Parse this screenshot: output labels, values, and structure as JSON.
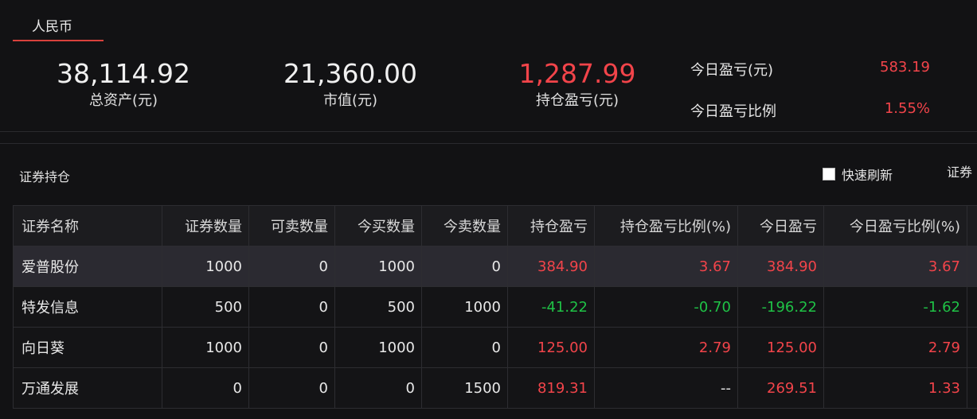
{
  "tab": {
    "label": "人民币"
  },
  "summary": {
    "total_assets": {
      "value": "38,114.92",
      "label": "总资产(元)"
    },
    "market_value": {
      "value": "21,360.00",
      "label": "市值(元)"
    },
    "position_pnl": {
      "value": "1,287.99",
      "label": "持仓盈亏(元)"
    },
    "today_pnl": {
      "label": "今日盈亏(元)",
      "value": "583.19"
    },
    "today_pnl_ratio": {
      "label": "今日盈亏比例",
      "value": "1.55%"
    }
  },
  "holdings": {
    "title": "证券持仓",
    "refresh_label": "快速刷新",
    "cut_label": "证券",
    "columns": [
      "证券名称",
      "证券数量",
      "可卖数量",
      "今买数量",
      "今卖数量",
      "持仓盈亏",
      "持仓盈亏比例(%)",
      "今日盈亏",
      "今日盈亏比例(%)"
    ],
    "rows": [
      {
        "name": "爱普股份",
        "qty": "1000",
        "sellable": "0",
        "bought": "1000",
        "sold": "0",
        "pnl": "384.90",
        "pnl_ratio": "3.67",
        "today": "384.90",
        "today_ratio": "3.67"
      },
      {
        "name": "特发信息",
        "qty": "500",
        "sellable": "0",
        "bought": "500",
        "sold": "1000",
        "pnl": "-41.22",
        "pnl_ratio": "-0.70",
        "today": "-196.22",
        "today_ratio": "-1.62"
      },
      {
        "name": "向日葵",
        "qty": "1000",
        "sellable": "0",
        "bought": "1000",
        "sold": "0",
        "pnl": "125.00",
        "pnl_ratio": "2.79",
        "today": "125.00",
        "today_ratio": "2.79"
      },
      {
        "name": "万通发展",
        "qty": "0",
        "sellable": "0",
        "bought": "0",
        "sold": "1500",
        "pnl": "819.31",
        "pnl_ratio": "--",
        "today": "269.51",
        "today_ratio": "1.33"
      }
    ]
  },
  "colors": {
    "up": "#f2444a",
    "down": "#1fc246",
    "accent": "#d9413c",
    "background": "#121214"
  }
}
